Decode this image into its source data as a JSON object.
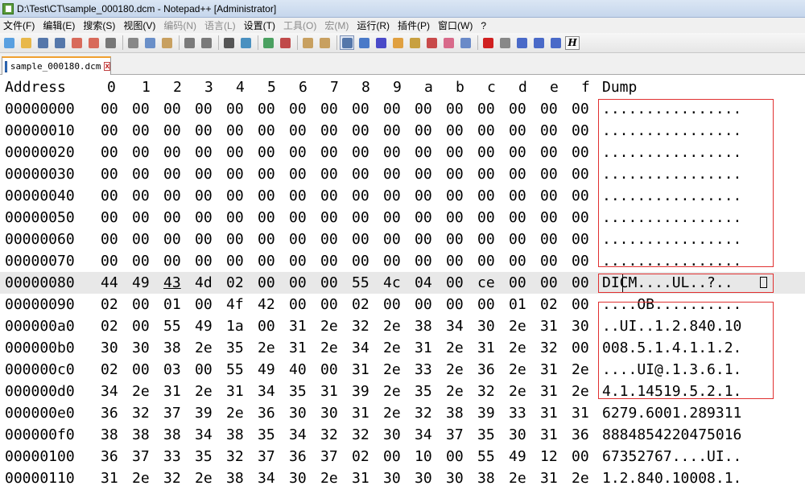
{
  "window": {
    "title": "D:\\Test\\CT\\sample_000180.dcm - Notepad++ [Administrator]"
  },
  "menu": [
    {
      "label": "文件(F)",
      "disabled": false
    },
    {
      "label": "编辑(E)",
      "disabled": false
    },
    {
      "label": "搜索(S)",
      "disabled": false
    },
    {
      "label": "视图(V)",
      "disabled": false
    },
    {
      "label": "编码(N)",
      "disabled": true
    },
    {
      "label": "语言(L)",
      "disabled": true
    },
    {
      "label": "设置(T)",
      "disabled": false
    },
    {
      "label": "工具(O)",
      "disabled": true
    },
    {
      "label": "宏(M)",
      "disabled": true
    },
    {
      "label": "运行(R)",
      "disabled": false
    },
    {
      "label": "插件(P)",
      "disabled": false
    },
    {
      "label": "窗口(W)",
      "disabled": false
    },
    {
      "label": "?",
      "disabled": false
    }
  ],
  "toolbar": {
    "buttons": [
      {
        "icon": "new-file-icon",
        "color": "#5aa0e0"
      },
      {
        "icon": "open-file-icon",
        "color": "#e8b84a"
      },
      {
        "icon": "save-icon",
        "color": "#5577aa"
      },
      {
        "icon": "save-all-icon",
        "color": "#5577aa"
      },
      {
        "icon": "close-icon",
        "color": "#d86a5a"
      },
      {
        "icon": "close-all-icon",
        "color": "#d86a5a"
      },
      {
        "icon": "print-icon",
        "color": "#777777"
      },
      {
        "sep": true
      },
      {
        "icon": "cut-icon",
        "color": "#888888"
      },
      {
        "icon": "copy-icon",
        "color": "#6a8fc8"
      },
      {
        "icon": "paste-icon",
        "color": "#c8a060"
      },
      {
        "sep": true
      },
      {
        "icon": "undo-icon",
        "color": "#7a7a7a"
      },
      {
        "icon": "redo-icon",
        "color": "#7a7a7a"
      },
      {
        "sep": true
      },
      {
        "icon": "find-icon",
        "color": "#555555"
      },
      {
        "icon": "replace-icon",
        "color": "#4a90c0"
      },
      {
        "sep": true
      },
      {
        "icon": "zoom-in-icon",
        "color": "#4aa060"
      },
      {
        "icon": "zoom-out-icon",
        "color": "#c04a4a"
      },
      {
        "sep": true
      },
      {
        "icon": "sync-vertical-icon",
        "color": "#c8a060"
      },
      {
        "icon": "sync-horizontal-icon",
        "color": "#c8a060"
      },
      {
        "sep": true
      },
      {
        "icon": "word-wrap-icon",
        "color": "#5577aa",
        "active": true
      },
      {
        "icon": "show-all-chars-icon",
        "color": "#4a7ac8"
      },
      {
        "icon": "indent-guide-icon",
        "color": "#4a4ac8"
      },
      {
        "icon": "udl-icon",
        "color": "#e0a040"
      },
      {
        "icon": "doc-map-icon",
        "color": "#c8a040"
      },
      {
        "icon": "function-list-icon",
        "color": "#c84a4a"
      },
      {
        "icon": "folder-workspace-icon",
        "color": "#d86a8a"
      },
      {
        "icon": "monitoring-icon",
        "color": "#6a8ac8"
      },
      {
        "sep": true
      },
      {
        "icon": "record-macro-icon",
        "color": "#d02020"
      },
      {
        "icon": "stop-macro-icon",
        "color": "#888888"
      },
      {
        "icon": "play-macro-icon",
        "color": "#4a6ac8"
      },
      {
        "icon": "run-macro-multiple-icon",
        "color": "#4a6ac8"
      },
      {
        "icon": "save-macro-icon",
        "color": "#4a6ac8"
      }
    ],
    "hex_button_label": "H"
  },
  "tab": {
    "label": "sample_000180.dcm",
    "close_label": "x"
  },
  "hex": {
    "header": {
      "address": "Address",
      "cols": [
        "0",
        "1",
        "2",
        "3",
        "4",
        "5",
        "6",
        "7",
        "8",
        "9",
        "a",
        "b",
        "c",
        "d",
        "e",
        "f"
      ],
      "dump": "Dump"
    },
    "rows": [
      {
        "addr": "00000000",
        "bytes": [
          "00",
          "00",
          "00",
          "00",
          "00",
          "00",
          "00",
          "00",
          "00",
          "00",
          "00",
          "00",
          "00",
          "00",
          "00",
          "00"
        ],
        "dump": "................"
      },
      {
        "addr": "00000010",
        "bytes": [
          "00",
          "00",
          "00",
          "00",
          "00",
          "00",
          "00",
          "00",
          "00",
          "00",
          "00",
          "00",
          "00",
          "00",
          "00",
          "00"
        ],
        "dump": "................"
      },
      {
        "addr": "00000020",
        "bytes": [
          "00",
          "00",
          "00",
          "00",
          "00",
          "00",
          "00",
          "00",
          "00",
          "00",
          "00",
          "00",
          "00",
          "00",
          "00",
          "00"
        ],
        "dump": "................"
      },
      {
        "addr": "00000030",
        "bytes": [
          "00",
          "00",
          "00",
          "00",
          "00",
          "00",
          "00",
          "00",
          "00",
          "00",
          "00",
          "00",
          "00",
          "00",
          "00",
          "00"
        ],
        "dump": "................"
      },
      {
        "addr": "00000040",
        "bytes": [
          "00",
          "00",
          "00",
          "00",
          "00",
          "00",
          "00",
          "00",
          "00",
          "00",
          "00",
          "00",
          "00",
          "00",
          "00",
          "00"
        ],
        "dump": "................"
      },
      {
        "addr": "00000050",
        "bytes": [
          "00",
          "00",
          "00",
          "00",
          "00",
          "00",
          "00",
          "00",
          "00",
          "00",
          "00",
          "00",
          "00",
          "00",
          "00",
          "00"
        ],
        "dump": "................"
      },
      {
        "addr": "00000060",
        "bytes": [
          "00",
          "00",
          "00",
          "00",
          "00",
          "00",
          "00",
          "00",
          "00",
          "00",
          "00",
          "00",
          "00",
          "00",
          "00",
          "00"
        ],
        "dump": "................"
      },
      {
        "addr": "00000070",
        "bytes": [
          "00",
          "00",
          "00",
          "00",
          "00",
          "00",
          "00",
          "00",
          "00",
          "00",
          "00",
          "00",
          "00",
          "00",
          "00",
          "00"
        ],
        "dump": "................"
      },
      {
        "addr": "00000080",
        "bytes": [
          "44",
          "49",
          "43",
          "4d",
          "02",
          "00",
          "00",
          "00",
          "55",
          "4c",
          "04",
          "00",
          "ce",
          "00",
          "00",
          "00"
        ],
        "dump": "DICM....UL..?..",
        "highlight": true,
        "cursor_col": 2,
        "dump_tail_box": true
      },
      {
        "addr": "00000090",
        "bytes": [
          "02",
          "00",
          "01",
          "00",
          "4f",
          "42",
          "00",
          "00",
          "02",
          "00",
          "00",
          "00",
          "00",
          "01",
          "02",
          "00"
        ],
        "dump": "....OB.........."
      },
      {
        "addr": "000000a0",
        "bytes": [
          "02",
          "00",
          "55",
          "49",
          "1a",
          "00",
          "31",
          "2e",
          "32",
          "2e",
          "38",
          "34",
          "30",
          "2e",
          "31",
          "30"
        ],
        "dump": "..UI..1.2.840.10"
      },
      {
        "addr": "000000b0",
        "bytes": [
          "30",
          "30",
          "38",
          "2e",
          "35",
          "2e",
          "31",
          "2e",
          "34",
          "2e",
          "31",
          "2e",
          "31",
          "2e",
          "32",
          "00"
        ],
        "dump": "008.5.1.4.1.1.2."
      },
      {
        "addr": "000000c0",
        "bytes": [
          "02",
          "00",
          "03",
          "00",
          "55",
          "49",
          "40",
          "00",
          "31",
          "2e",
          "33",
          "2e",
          "36",
          "2e",
          "31",
          "2e"
        ],
        "dump": "....UI@.1.3.6.1."
      },
      {
        "addr": "000000d0",
        "bytes": [
          "34",
          "2e",
          "31",
          "2e",
          "31",
          "34",
          "35",
          "31",
          "39",
          "2e",
          "35",
          "2e",
          "32",
          "2e",
          "31",
          "2e"
        ],
        "dump": "4.1.14519.5.2.1."
      },
      {
        "addr": "000000e0",
        "bytes": [
          "36",
          "32",
          "37",
          "39",
          "2e",
          "36",
          "30",
          "30",
          "31",
          "2e",
          "32",
          "38",
          "39",
          "33",
          "31",
          "31"
        ],
        "dump": "6279.6001.289311"
      },
      {
        "addr": "000000f0",
        "bytes": [
          "38",
          "38",
          "38",
          "34",
          "38",
          "35",
          "34",
          "32",
          "32",
          "30",
          "34",
          "37",
          "35",
          "30",
          "31",
          "36"
        ],
        "dump": "8884854220475016"
      },
      {
        "addr": "00000100",
        "bytes": [
          "36",
          "37",
          "33",
          "35",
          "32",
          "37",
          "36",
          "37",
          "02",
          "00",
          "10",
          "00",
          "55",
          "49",
          "12",
          "00"
        ],
        "dump": "67352767....UI.."
      },
      {
        "addr": "00000110",
        "bytes": [
          "31",
          "2e",
          "32",
          "2e",
          "38",
          "34",
          "30",
          "2e",
          "31",
          "30",
          "30",
          "30",
          "38",
          "2e",
          "31",
          "2e"
        ],
        "dump": "1.2.840.10008.1."
      }
    ]
  }
}
